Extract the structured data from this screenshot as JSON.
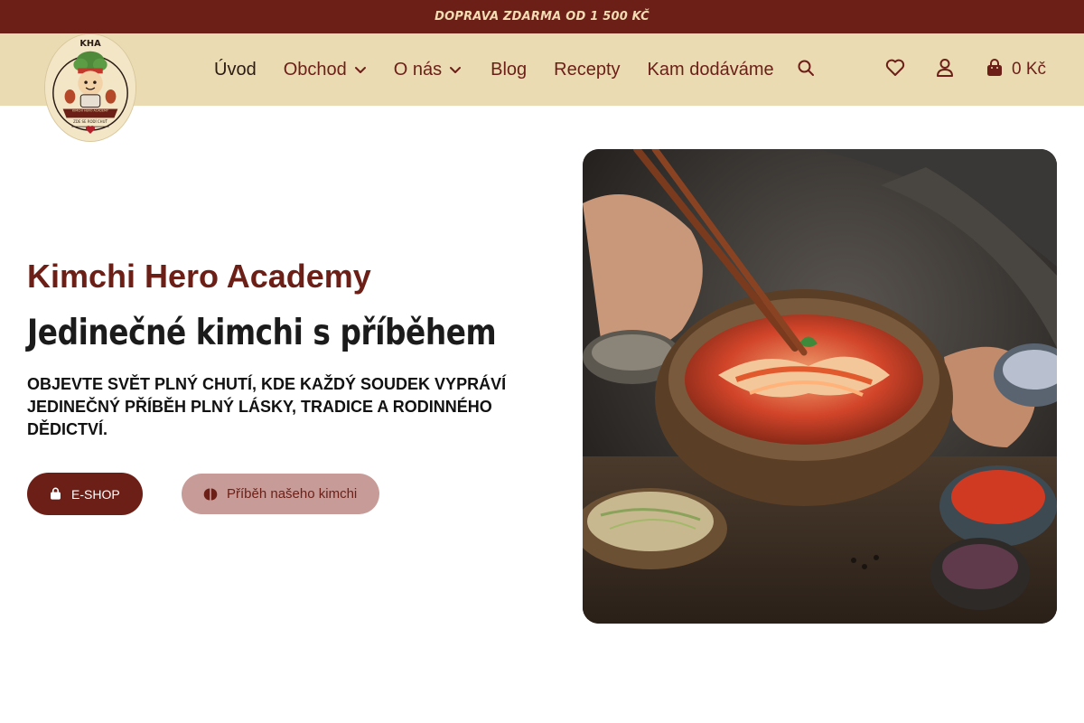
{
  "promo_bar": {
    "text": "DOPRAVA ZDARMA OD 1 500 KČ"
  },
  "logo": {
    "alt_text": "KHA",
    "ring_text": "KIMCHI HERO ACADEMY",
    "motto": "ZDE SE RODÍ CHUŤ"
  },
  "nav": {
    "items": [
      {
        "label": "Úvod",
        "active": true
      },
      {
        "label": "Obchod",
        "has_dropdown": true
      },
      {
        "label": "O nás",
        "has_dropdown": true
      },
      {
        "label": "Blog"
      },
      {
        "label": "Recepty"
      },
      {
        "label": "Kam dodáváme"
      }
    ],
    "icons": [
      "search-icon",
      "heart-icon",
      "user-icon",
      "shopping-bag-icon"
    ],
    "cart_total": "0 Kč"
  },
  "hero": {
    "brand": "Kimchi Hero Academy",
    "tagline": "Jedinečné kimchi s příběhem",
    "lead": "OBJEVTE SVĚT PLNÝ CHUTÍ, KDE KAŽDÝ SOUDEK VYPRÁVÍ JEDINEČNÝ PŘÍBĚH PLNÝ LÁSKY, TRADICE A RODINNÉHO DĚDICTVÍ.",
    "primary_button": "E-SHOP",
    "secondary_button": "Příběh našeho kimchi"
  },
  "colors": {
    "brand": "#6b1f16",
    "header_bg": "#eadbb3",
    "secondary_button": "#c79b98",
    "promo_text": "#f3dcb4"
  }
}
